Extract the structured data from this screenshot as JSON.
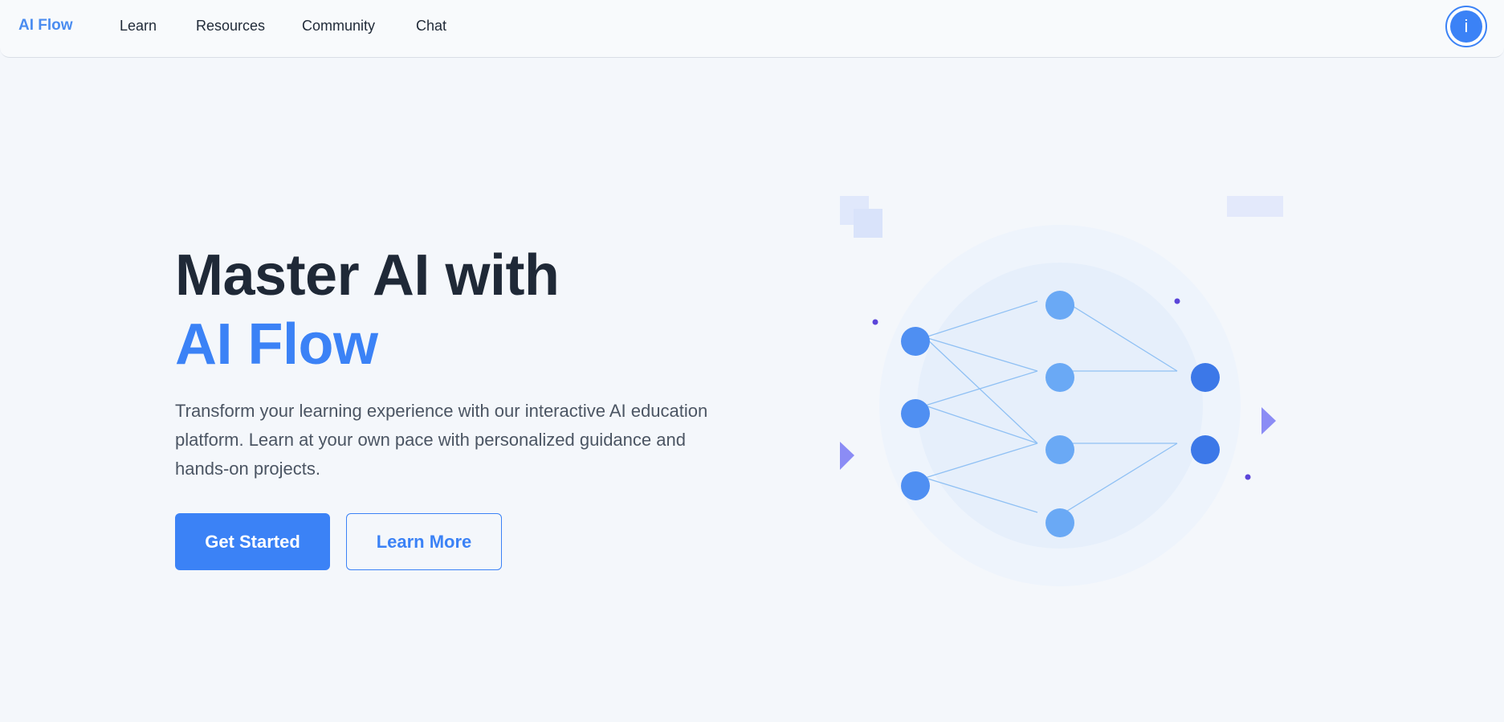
{
  "nav": {
    "brand": "AI Flow",
    "links": [
      "Learn",
      "Resources",
      "Community",
      "Chat"
    ],
    "info_label": "i"
  },
  "hero": {
    "title_line1": "Master AI with",
    "title_line2": "AI Flow",
    "description": "Transform your learning experience with our interactive AI education platform. Learn at your own pace with personalized guidance and hands-on projects.",
    "primary_button": "Get Started",
    "secondary_button": "Learn More"
  },
  "colors": {
    "accent": "#3b82f6",
    "node_input": "#4f8ff2",
    "node_hidden": "#6aa9f5",
    "node_output": "#3c78e8",
    "decor_violet": "#8b8cf5"
  },
  "icons": {
    "info": "info-icon",
    "illustration": "neural-network-illustration"
  }
}
